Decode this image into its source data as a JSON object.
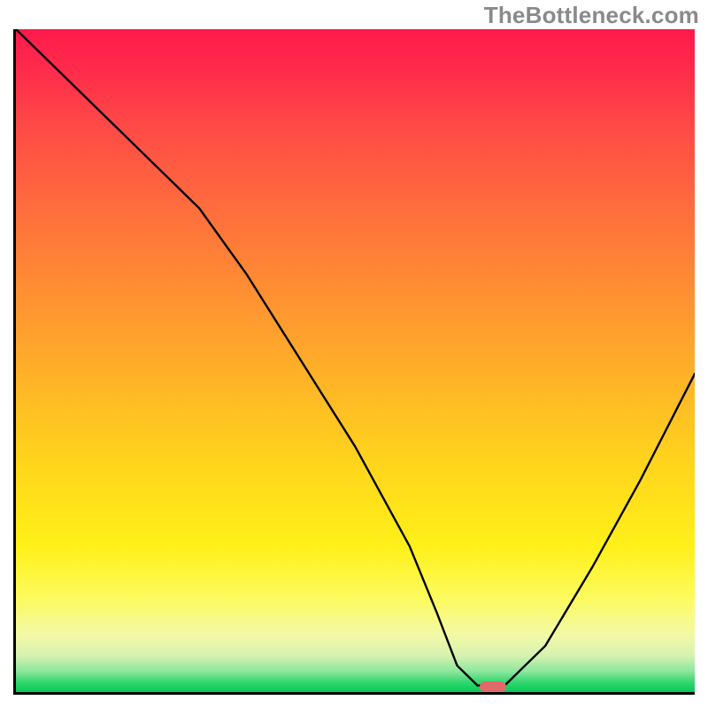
{
  "watermark": "TheBottleneck.com",
  "colors": {
    "grad_top": "#ff1a4b",
    "grad_mid1": "#ff8b34",
    "grad_mid2": "#ffd61c",
    "grad_low": "#fcfb60",
    "grad_bottom": "#06c957",
    "curve": "#000000",
    "marker": "#e06a6a",
    "axis": "#000000"
  },
  "chart_data": {
    "type": "line",
    "title": "",
    "xlabel": "",
    "ylabel": "",
    "xlim": [
      0,
      100
    ],
    "ylim": [
      0,
      100
    ],
    "grid": false,
    "legend": false,
    "series": [
      {
        "name": "bottleneck-curve",
        "x": [
          0,
          10,
          20,
          27,
          34,
          42,
          50,
          58,
          62,
          65,
          68,
          72,
          78,
          85,
          92,
          100
        ],
        "y": [
          100,
          90,
          80,
          73,
          63,
          50,
          37,
          22,
          12,
          4,
          1,
          1,
          7,
          19,
          32,
          48
        ]
      }
    ],
    "marker": {
      "name": "optimal-range",
      "x_center": 70,
      "width_pct": 4,
      "y": 0.8
    },
    "background_gradient_stops": [
      {
        "pos": 0.0,
        "hex": "#ff1a4b"
      },
      {
        "pos": 0.26,
        "hex": "#ff6a3e"
      },
      {
        "pos": 0.52,
        "hex": "#ffb128"
      },
      {
        "pos": 0.78,
        "hex": "#fff019"
      },
      {
        "pos": 0.92,
        "hex": "#f2f9a8"
      },
      {
        "pos": 1.0,
        "hex": "#06c957"
      }
    ]
  }
}
